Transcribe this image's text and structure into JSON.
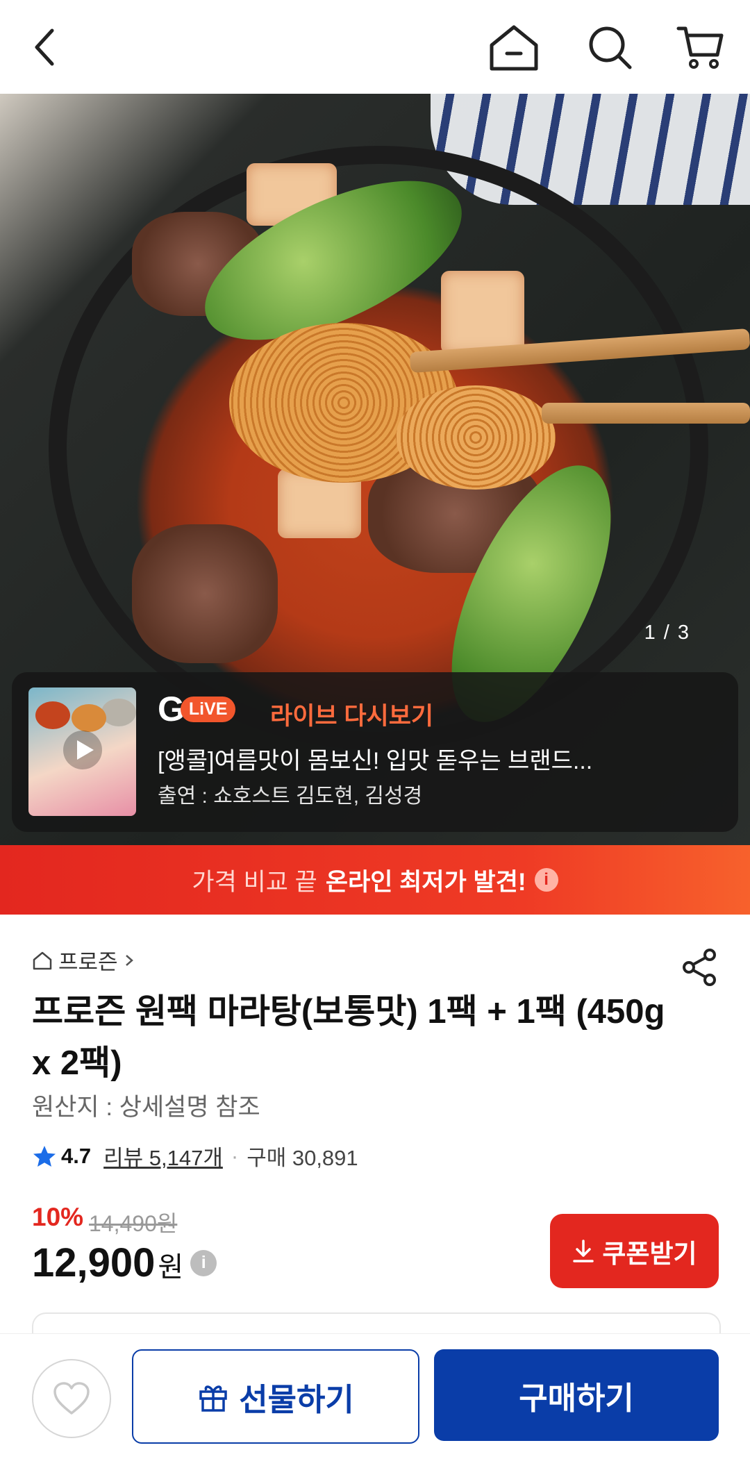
{
  "header": {
    "back_icon": "chevron-left-icon",
    "home_icon": "home-icon",
    "search_icon": "search-icon",
    "cart_icon": "cart-icon"
  },
  "gallery": {
    "counter": "1 / 3"
  },
  "live": {
    "badge_g": "G",
    "badge_live": "LiVE",
    "replay_label": "라이브 다시보기",
    "title": "[앵콜]여름맛이 몸보신! 입맛 돋우는 브랜드...",
    "cast": "출연 : 쇼호스트 김도현, 김성경"
  },
  "banner": {
    "light": "가격 비교 끝",
    "strong": "온라인 최저가 발견!",
    "info": "i"
  },
  "product": {
    "brand": "프로즌",
    "title": "프로즌 원팩 마라탕(보통맛) 1팩 + 1팩 (450g x 2팩)",
    "origin": "원산지 : 상세설명 참조",
    "rating": "4.7",
    "reviews": "리뷰 5,147개",
    "separator": "·",
    "purchases": "구매 30,891",
    "discount": "10%",
    "original_price": "14,490원",
    "price": "12,900",
    "currency": "원",
    "price_info": "i",
    "coupon_label": "쿠폰받기"
  },
  "bottom": {
    "gift_label": "선물하기",
    "buy_label": "구매하기"
  },
  "colors": {
    "accent_red": "#e3271f",
    "brand_blue": "#0a3da8"
  }
}
